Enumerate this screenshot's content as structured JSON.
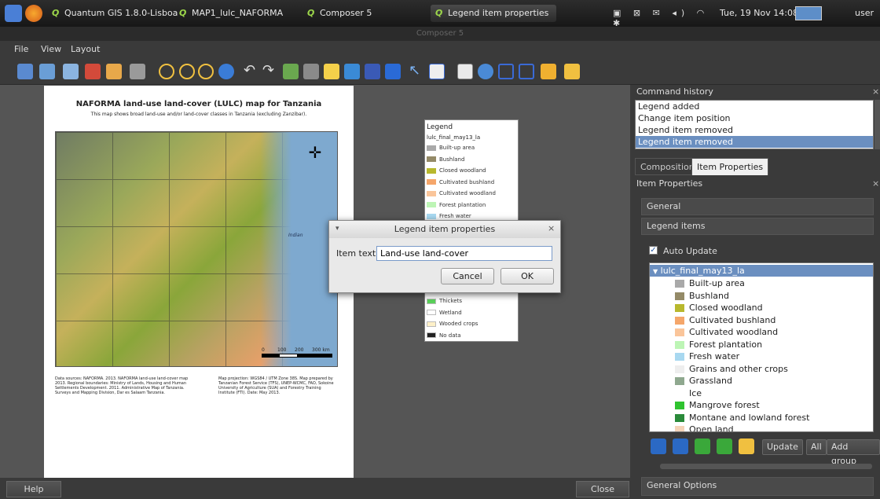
{
  "taskbar": {
    "tasks": [
      {
        "label": "Quantum GIS 1.8.0-Lisboa -..."
      },
      {
        "label": "MAP1_lulc_NAFORMA"
      },
      {
        "label": "Composer 5"
      },
      {
        "label": "Legend item properties"
      }
    ],
    "clock": "Tue, 19 Nov  14:08",
    "user": "user"
  },
  "window": {
    "title": "Composer 5"
  },
  "menubar": {
    "file": "File",
    "view": "View",
    "layout": "Layout"
  },
  "map_page": {
    "title": "NAFORMA land-use land-cover (LULC) map for Tanzania",
    "subtitle": "This map shows broad land-use and/or land-cover classes in Tanzania (excluding Zanzibar).",
    "sea_label": "Indian",
    "scalebar": {
      "t0": "0",
      "t1": "100",
      "t2": "200",
      "t3": "300 km"
    },
    "sources": "Data sources: NAFORMA. 2013. NAFORMA land-use land-cover map 2013. Regional boundaries: Ministry of Lands, Housing and Human Settlements Development. 2011. Administrative Map of Tanzania. Surveys and Mapping Division, Dar es Salaam Tanzania.",
    "projection": "Map projection: WGS84 / UTM Zone 38S. Map prepared by Tanzanian Forest Service (TFS), UNEP-WCMC, FAO, Sokoine University of Agriculture (SUA) and Forestry Training Institute (FTI). Date: May 2013."
  },
  "legend_item": {
    "title": "Legend",
    "layer": "lulc_final_may13_la",
    "top_items": [
      {
        "label": "Built-up area",
        "color": "#a9a9a9"
      },
      {
        "label": "Bushland",
        "color": "#948a67"
      },
      {
        "label": "Closed woodland",
        "color": "#b8b82d"
      },
      {
        "label": "Cultivated bushland",
        "color": "#f5a66a"
      },
      {
        "label": "Cultivated woodland",
        "color": "#fac59a"
      },
      {
        "label": "Forest plantation",
        "color": "#bdf5b5"
      },
      {
        "label": "Fresh water",
        "color": "#a8d8f0"
      }
    ],
    "bottom_items": [
      {
        "label": "Thickets",
        "color": "#5ad15a"
      },
      {
        "label": "Wetland",
        "color": "#ffffff"
      },
      {
        "label": "Wooded crops",
        "color": "#fdf0c8"
      },
      {
        "label": "No data",
        "color": "#222222"
      }
    ]
  },
  "dialog": {
    "title": "Legend item properties",
    "label": "Item text",
    "value": "Land-use land-cover",
    "cancel": "Cancel",
    "ok": "OK"
  },
  "command_history": {
    "title": "Command history",
    "items": [
      "Legend added",
      "Change item position",
      "Legend item removed",
      "Legend item removed"
    ]
  },
  "tabs": {
    "composition": "Composition",
    "item_properties": "Item Properties"
  },
  "item_properties": {
    "title": "Item Properties",
    "general": "General",
    "legend_items": "Legend items",
    "auto_update": "Auto Update",
    "layer": "lulc_final_may13_la",
    "classes": [
      {
        "label": "Built-up area",
        "color": "#a9a9a9"
      },
      {
        "label": "Bushland",
        "color": "#948a67"
      },
      {
        "label": "Closed woodland",
        "color": "#b8b82d"
      },
      {
        "label": "Cultivated bushland",
        "color": "#f5a66a"
      },
      {
        "label": "Cultivated woodland",
        "color": "#fac59a"
      },
      {
        "label": "Forest plantation",
        "color": "#bdf5b5"
      },
      {
        "label": "Fresh water",
        "color": "#a8d8f0"
      },
      {
        "label": "Grains and other crops",
        "color": "#eeeeee"
      },
      {
        "label": "Grassland",
        "color": "#8fa88f"
      },
      {
        "label": "Ice",
        "color": "#ffffff"
      },
      {
        "label": "Mangrove forest",
        "color": "#2fc32f"
      },
      {
        "label": "Montane and lowland forest",
        "color": "#2a8a3a"
      },
      {
        "label": "Open land",
        "color": "#f5d3b8"
      }
    ],
    "update": "Update",
    "all": "All",
    "add_group": "Add group",
    "general_options": "General Options"
  },
  "bottom": {
    "help": "Help",
    "close": "Close"
  }
}
